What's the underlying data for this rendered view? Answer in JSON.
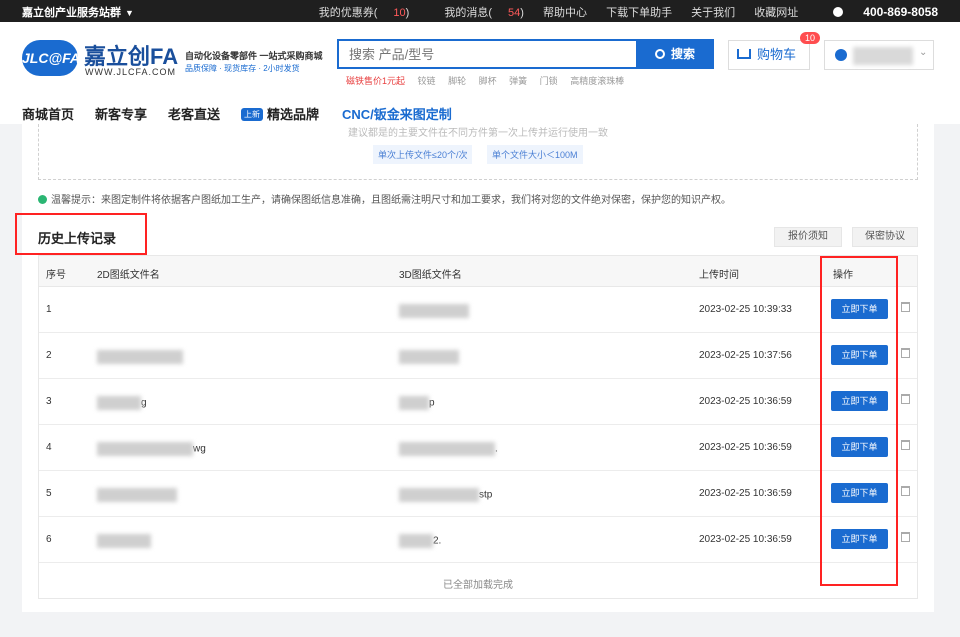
{
  "topbar": {
    "site_label": "嘉立创产业服务站群",
    "links": {
      "coupons_label": "我的优惠券",
      "coupons_count": "10",
      "messages_label": "我的消息",
      "messages_count": "54",
      "help": "帮助中心",
      "download": "下载下单助手",
      "about": "关于我们",
      "favorite": "收藏网址",
      "phone": "400-869-8058"
    }
  },
  "header": {
    "logo_badge": "JLC@FA",
    "logo_cn": "嘉立创FA",
    "logo_url": "WWW.JLCFA.COM",
    "slogan1": "自动化设备零部件 一站式采购商城",
    "slogan2": "品质保障 · 现货库存 · 2小时发货",
    "search_placeholder": "搜索 产品/型号",
    "search_button": "搜索",
    "search_hints": [
      "磁铁售价1元起",
      "铰链",
      "脚轮",
      "脚杯",
      "弹簧",
      "门锁",
      "高精度滚珠棒"
    ],
    "cart_label": "购物车",
    "cart_badge": "10"
  },
  "nav": {
    "home": "商城首页",
    "new_customer": "新客专享",
    "old_customer": "老客直送",
    "new_tag": "上新",
    "brands": "精选品牌",
    "cnc": "CNC/钣金来图定制"
  },
  "upload": {
    "truncated_text": "建议都是的主要文件在不同方件第一次上传并运行使用一致",
    "chip1": "单次上传文件≤20个/次",
    "chip2": "单个文件大小＜100M",
    "tip": "温馨提示：来图定制件将依据客户图纸加工生产，请确保图纸信息准确，且图纸需注明尺寸和加工要求，我们将对您的文件绝对保密，保护您的知识产权。"
  },
  "history": {
    "title": "历史上传记录",
    "quote_notice": "报价须知",
    "privacy": "保密协议",
    "columns": {
      "index": "序号",
      "file2d": "2D图纸文件名",
      "file3d": "3D图纸文件名",
      "upload_time": "上传时间",
      "action": "操作"
    },
    "rows": [
      {
        "index": "1",
        "file2d_suffix": "",
        "file3d_suffix": "",
        "time": "2023-02-25 10:39:33",
        "order": "立即下单"
      },
      {
        "index": "2",
        "file2d_suffix": "",
        "file3d_suffix": "",
        "time": "2023-02-25 10:37:56",
        "order": "立即下单"
      },
      {
        "index": "3",
        "file2d_suffix": "g",
        "file3d_suffix": "p",
        "time": "2023-02-25 10:36:59",
        "order": "立即下单"
      },
      {
        "index": "4",
        "file2d_suffix": "wg",
        "file3d_suffix": ".",
        "time": "2023-02-25 10:36:59",
        "order": "立即下单"
      },
      {
        "index": "5",
        "file2d_suffix": "",
        "file3d_suffix": "stp",
        "time": "2023-02-25 10:36:59",
        "order": "立即下单"
      },
      {
        "index": "6",
        "file2d_suffix": "",
        "file3d_suffix": "2.",
        "time": "2023-02-25 10:36:59",
        "order": "立即下单"
      }
    ],
    "footer": "已全部加载完成"
  },
  "colors": {
    "brand": "#1a6bd0",
    "highlight_box": "#ff2222",
    "badge": "#ff4d4f"
  }
}
